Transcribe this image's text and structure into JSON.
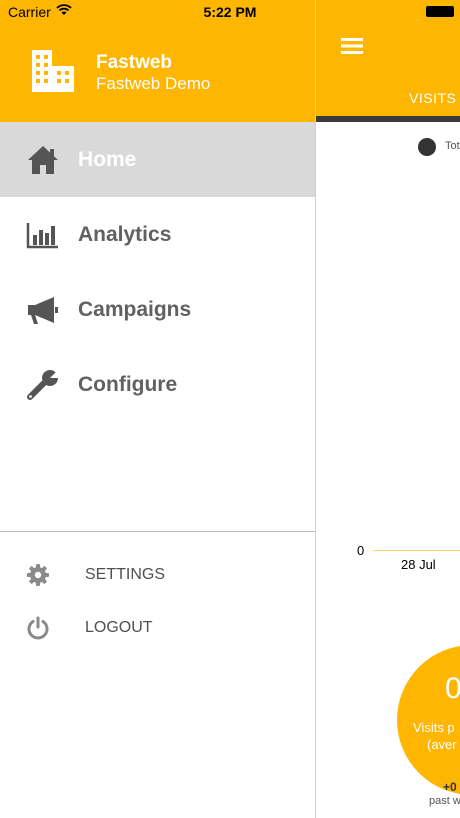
{
  "status_bar": {
    "carrier": "Carrier",
    "time": "5:22 PM"
  },
  "drawer": {
    "company_name": "Fastweb",
    "subtitle": "Fastweb Demo",
    "nav": [
      {
        "label": "Home",
        "icon": "home-icon",
        "active": true
      },
      {
        "label": "Analytics",
        "icon": "bar-chart-icon",
        "active": false
      },
      {
        "label": "Campaigns",
        "icon": "megaphone-icon",
        "active": false
      },
      {
        "label": "Configure",
        "icon": "wrench-icon",
        "active": false
      }
    ],
    "footer": [
      {
        "label": "SETTINGS",
        "icon": "gear-icon"
      },
      {
        "label": "LOGOUT",
        "icon": "power-icon"
      }
    ]
  },
  "content": {
    "tab_label": "VISITS",
    "legend_label": "Tot",
    "axis_zero": "0",
    "axis_date": "28 Jul",
    "stat_value": "0",
    "stat_line1": "Visits p",
    "stat_line2": "(aver",
    "change_value": "+0",
    "change_label": "past w"
  },
  "colors": {
    "accent": "#FFB600",
    "active_row": "#d9d9d9",
    "nav_text": "#616161"
  }
}
